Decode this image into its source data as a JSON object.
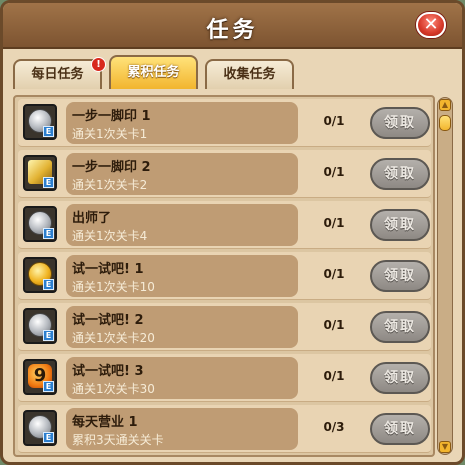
{
  "window": {
    "title": "任务",
    "close_glyph": "✕"
  },
  "tabs": [
    {
      "label": "每日任务",
      "active": false,
      "badge": "!"
    },
    {
      "label": "累积任务",
      "active": true
    },
    {
      "label": "收集任务",
      "active": false
    }
  ],
  "tasks": [
    {
      "name": "一步一脚印 1",
      "desc": "通关1次关卡1",
      "progress": "0/1",
      "button": "领取",
      "icon": "silver-coin-icon"
    },
    {
      "name": "一步一脚印 2",
      "desc": "通关1次关卡2",
      "progress": "0/1",
      "button": "领取",
      "icon": "lightning-card-icon"
    },
    {
      "name": "出师了",
      "desc": "通关1次关卡4",
      "progress": "0/1",
      "button": "领取",
      "icon": "silver-coin-icon"
    },
    {
      "name": "试一试吧! 1",
      "desc": "通关1次关卡10",
      "progress": "0/1",
      "button": "领取",
      "icon": "gold-coin-icon"
    },
    {
      "name": "试一试吧! 2",
      "desc": "通关1次关卡20",
      "progress": "0/1",
      "button": "领取",
      "icon": "silver-coin-icon"
    },
    {
      "name": "试一试吧! 3",
      "desc": "通关1次关卡30",
      "progress": "0/1",
      "button": "领取",
      "icon": "nine-card-icon"
    },
    {
      "name": "每天营业 1",
      "desc": "累积3天通关关卡",
      "progress": "0/3",
      "button": "领取",
      "icon": "silver-coin-icon"
    }
  ],
  "item_tag": "E",
  "nine_glyph": "9",
  "scroll": {
    "up": "▲",
    "down": "▼"
  }
}
